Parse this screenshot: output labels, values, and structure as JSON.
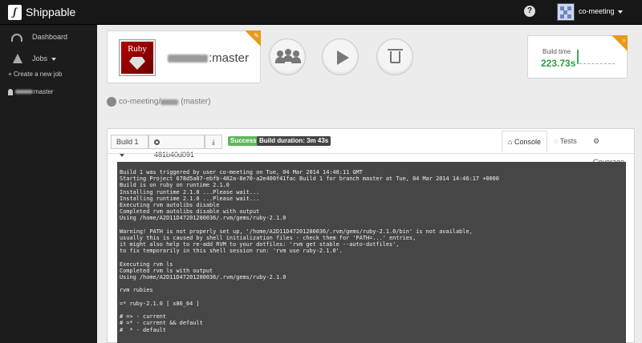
{
  "topbar": {
    "brand": "Shippable",
    "help_glyph": "?",
    "user": "co-meeting"
  },
  "sidebar": {
    "dashboard": "Dashboard",
    "jobs": "Jobs",
    "create_job": "+ Create a new job",
    "job_item": "master"
  },
  "header": {
    "ruby_label": "Ruby",
    "project_branch": ":master",
    "build_time_label": "Build time",
    "build_time_value": "223.73s",
    "repo_path": "co-meeting/",
    "repo_branch": "(master)"
  },
  "toolbar": {
    "build_select": "Build 1",
    "commit": "481b40d091",
    "status": "Success",
    "duration": "Build duration: 3m 43s"
  },
  "tabs": {
    "console": "Console",
    "tests": "Tests",
    "coverage": "Coverage"
  },
  "console_lines": [
    "Build 1 was triggered by user co-meeting on Tue, 04 Mar 2014 14:48:11 GMT",
    "Starting Project 678d5a07-ebfb-482a-8e70-a2e400f41fac Build 1 for branch master at Tue, 04 Mar 2014 14:46:17 +0000",
    "Build is on ruby on runtime 2.1.0",
    "Installing runtime 2.1.0 ...Please wait...",
    "Installing runtime 2.1.0 ...Please wait...",
    "Executing rvm autolibs disable",
    "Completed rvm autolibs disable with output",
    "Using /home/A2D11D47201280036/.rvm/gems/ruby-2.1.0",
    "",
    "Warning! PATH is not properly set up, '/home/A2D11D47201280036/.rvm/gems/ruby-2.1.0/bin' is not available,",
    "usually this is caused by shell initialization files - check them for 'PATH=...' entries,",
    "it might also help to re-add RVM to your dotfiles: 'rvm get stable --auto-dotfiles',",
    "to fix temporarily in this shell session run: 'rvm use ruby-2.1.0'.",
    "",
    "Executing rvm ls",
    "Completed rvm ls with output",
    "Using /home/A2D11D47201280036/.rvm/gems/ruby-2.1.0",
    "",
    "rvm rubies",
    "",
    "=* ruby-2.1.0 [ x86_64 ]",
    "",
    "# => - current",
    "# =* - current && default",
    "#  * - default"
  ],
  "colors": {
    "topbar": "#171717",
    "sidebar": "#1c1c1c",
    "success": "#5cb85c",
    "build_time": "#2e9e3e",
    "console_bg": "#464646",
    "corner_badge": "#e89a1a"
  },
  "icons": [
    "dashboard-icon",
    "flask-icon",
    "user-icon",
    "group-icon",
    "play-icon",
    "trash-icon",
    "github-icon",
    "commit-icon",
    "download-icon",
    "home-icon",
    "comments-icon",
    "gear-icon",
    "zoom-icon",
    "pencil-icon"
  ]
}
